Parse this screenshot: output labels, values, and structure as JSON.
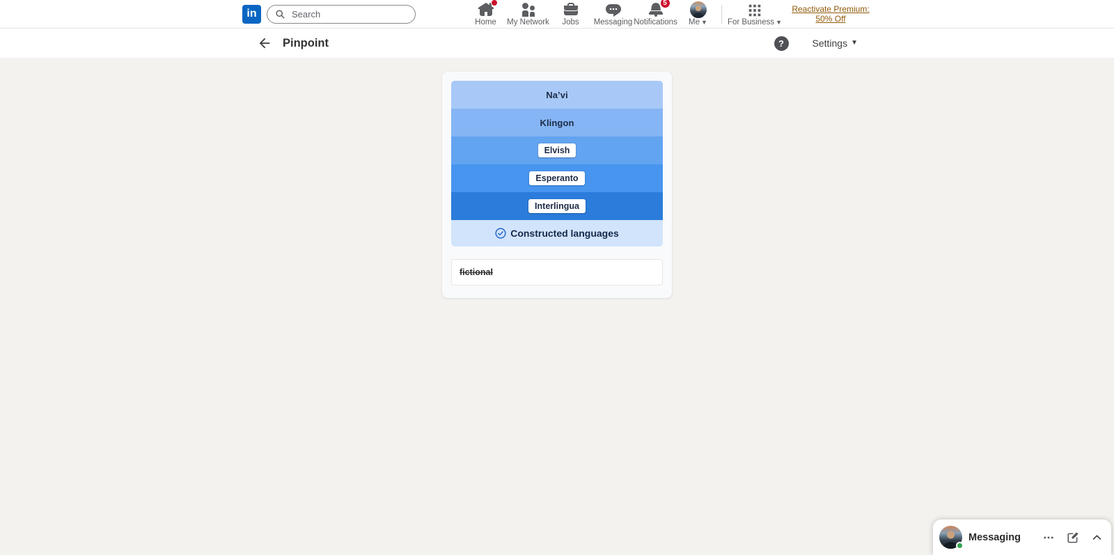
{
  "topnav": {
    "logo_text": "in",
    "search_placeholder": "Search",
    "items": [
      {
        "label": "Home",
        "badge": "dot"
      },
      {
        "label": "My Network"
      },
      {
        "label": "Jobs"
      },
      {
        "label": "Messaging"
      },
      {
        "label": "Notifications",
        "badge": "5"
      },
      {
        "label": "Me",
        "has_caret": true
      }
    ],
    "for_business_label": "For Business",
    "premium_line1": "Reactivate Premium:",
    "premium_line2": "50% Off"
  },
  "header": {
    "title": "Pinpoint",
    "help_glyph": "?",
    "settings_label": "Settings"
  },
  "game": {
    "clues": [
      {
        "label": "Na’vi",
        "color": "#a8c9f7",
        "boxed": false
      },
      {
        "label": "Klingon",
        "color": "#85b5f4",
        "boxed": false
      },
      {
        "label": "Elvish",
        "color": "#63a4f1",
        "boxed": true
      },
      {
        "label": "Esperanto",
        "color": "#4795ef",
        "boxed": true
      },
      {
        "label": "Interlingua",
        "color": "#2b7cdb",
        "boxed": true
      }
    ],
    "answer": {
      "label": "Constructed languages",
      "color": "#d2e4fb",
      "icon": "check-circle-icon"
    },
    "guess": {
      "text": "fictional",
      "struck": true
    }
  },
  "messaging_dock": {
    "title": "Messaging"
  },
  "icons": {
    "search-icon": "magnifier",
    "home-icon": "house",
    "my-network-icon": "two-people",
    "jobs-icon": "briefcase",
    "messaging-icon": "speech-bubble-dots",
    "notifications-icon": "bell",
    "me-avatar": "profile-photo",
    "grid-icon": "3x3-grid",
    "caret-down-icon": "triangle-down",
    "back-icon": "arrow-left",
    "help-icon": "question-mark-circle",
    "check-circle-icon": "circled-checkmark",
    "ellipsis-icon": "three-dots",
    "compose-icon": "pencil-square",
    "chevron-up-icon": "chevron-up",
    "presence-dot": "online-status"
  },
  "colors": {
    "brand_blue": "#0a66c2",
    "badge_red": "#cb112d",
    "premium_gold": "#915907",
    "presence_green": "#31a24c",
    "page_bg": "#f4f2ee"
  }
}
